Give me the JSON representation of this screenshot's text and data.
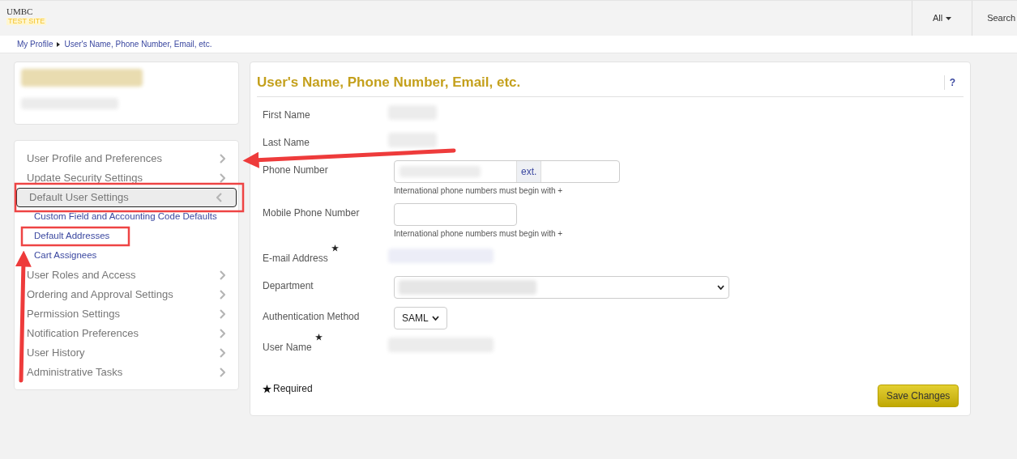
{
  "header": {
    "logo_text": "UMBC",
    "logo_subtext": "TEST SITE",
    "scope_dropdown": "All",
    "search_label": "Search"
  },
  "breadcrumb": [
    {
      "label": "My Profile"
    },
    {
      "label": "User's Name, Phone Number, Email, etc."
    }
  ],
  "sidebar": {
    "items": [
      {
        "kind": "section",
        "label": "User Profile and Preferences",
        "expanded": false,
        "selected": false
      },
      {
        "kind": "section",
        "label": "Update Security Settings",
        "expanded": false,
        "selected": false
      },
      {
        "kind": "section",
        "label": "Default User Settings",
        "expanded": true,
        "selected": true
      },
      {
        "kind": "link",
        "label": "Custom Field and Accounting Code Defaults"
      },
      {
        "kind": "link",
        "label": "Default Addresses"
      },
      {
        "kind": "link",
        "label": "Cart Assignees"
      },
      {
        "kind": "section",
        "label": "User Roles and Access",
        "expanded": false,
        "selected": false
      },
      {
        "kind": "section",
        "label": "Ordering and Approval Settings",
        "expanded": false,
        "selected": false
      },
      {
        "kind": "section",
        "label": "Permission Settings",
        "expanded": false,
        "selected": false
      },
      {
        "kind": "section",
        "label": "Notification Preferences",
        "expanded": false,
        "selected": false
      },
      {
        "kind": "section",
        "label": "User History",
        "expanded": false,
        "selected": false
      },
      {
        "kind": "section",
        "label": "Administrative Tasks",
        "expanded": false,
        "selected": false
      }
    ]
  },
  "form": {
    "title": "User's Name, Phone Number, Email, etc.",
    "help": "?",
    "fields": [
      {
        "kind": "redacted",
        "label": "First Name",
        "required": false
      },
      {
        "kind": "redacted",
        "label": "Last Name",
        "required": false
      },
      {
        "kind": "phone",
        "label": "Phone Number",
        "required": false,
        "ext_label": "ext.",
        "hint": "International phone numbers must begin with +"
      },
      {
        "kind": "input",
        "label": "Mobile Phone Number",
        "required": false,
        "hint": "International phone numbers must begin with +"
      },
      {
        "kind": "redacted",
        "label": "E-mail Address",
        "required": true
      },
      {
        "kind": "select_wide",
        "label": "Department",
        "required": false
      },
      {
        "kind": "select",
        "label": "Authentication Method",
        "required": false,
        "value": "SAML"
      },
      {
        "kind": "redacted",
        "label": "User Name",
        "required": true
      }
    ],
    "required_note": "Required",
    "save_button": "Save Changes"
  }
}
